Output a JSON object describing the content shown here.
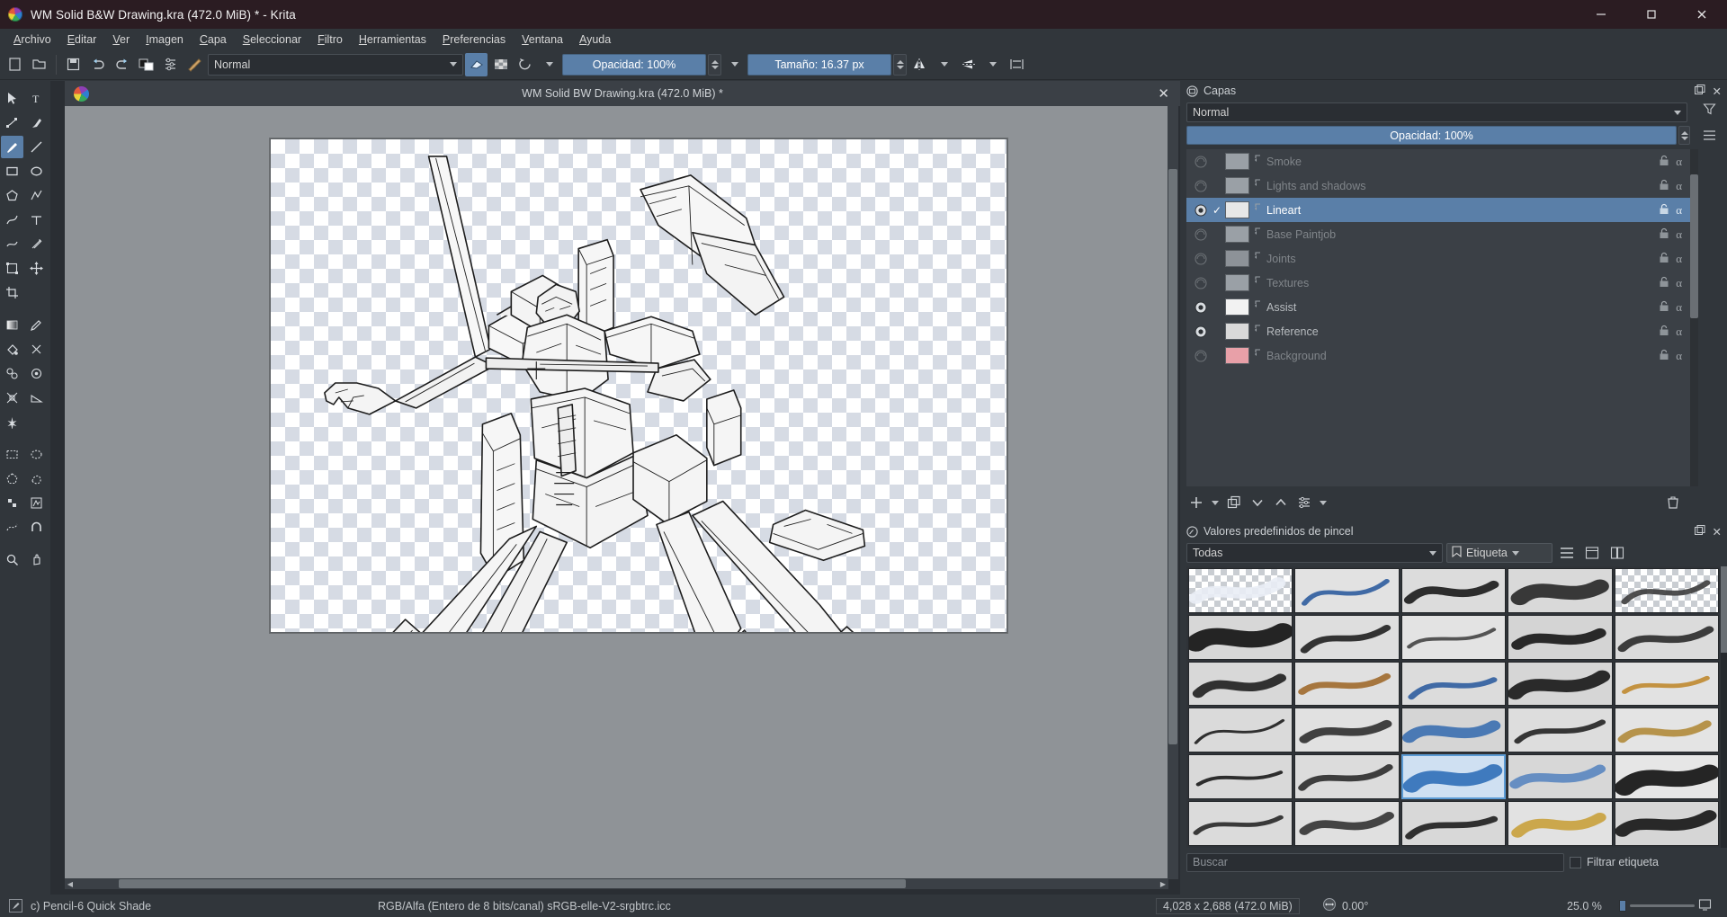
{
  "window": {
    "title": "WM Solid B&W Drawing.kra (472.0 MiB) * - Krita",
    "minimize_label": "—",
    "maximize_label": "❐",
    "close_label": "✕"
  },
  "menubar": {
    "items": [
      {
        "label": "Archivo"
      },
      {
        "label": "Editar"
      },
      {
        "label": "Ver"
      },
      {
        "label": "Imagen"
      },
      {
        "label": "Capa"
      },
      {
        "label": "Seleccionar"
      },
      {
        "label": "Filtro"
      },
      {
        "label": "Herramientas"
      },
      {
        "label": "Preferencias"
      },
      {
        "label": "Ventana"
      },
      {
        "label": "Ayuda"
      }
    ]
  },
  "toolbar": {
    "blend_mode": "Normal",
    "opacity_label": "Opacidad: 100%",
    "size_label": "Tamaño: 16.37 px"
  },
  "canvas": {
    "document_title": "WM Solid BW Drawing.kra (472.0 MiB) *",
    "close_label": "✕"
  },
  "layers_docker": {
    "title": "Capas",
    "blend_mode": "Normal",
    "opacity_label": "Opacidad: 100%",
    "float_label": "❐",
    "close_label": "✕",
    "items": [
      {
        "name": "Smoke",
        "visible": false,
        "selected": false,
        "checked": false,
        "thumb": "#9aa0a6"
      },
      {
        "name": "Lights and shadows",
        "visible": false,
        "selected": false,
        "checked": false,
        "thumb": "#9aa0a6"
      },
      {
        "name": "Lineart",
        "visible": true,
        "selected": true,
        "checked": true,
        "thumb": "#e7e7e7"
      },
      {
        "name": "Base Paintjob",
        "visible": false,
        "selected": false,
        "checked": false,
        "thumb": "#9aa0a6"
      },
      {
        "name": "Joints",
        "visible": false,
        "selected": false,
        "checked": false,
        "thumb": "#8d9298"
      },
      {
        "name": "Textures",
        "visible": false,
        "selected": false,
        "checked": false,
        "thumb": "#9aa0a6"
      },
      {
        "name": "Assist",
        "visible": true,
        "selected": false,
        "checked": false,
        "thumb": "#f2f2f2"
      },
      {
        "name": "Reference",
        "visible": true,
        "selected": false,
        "checked": false,
        "thumb": "#d9d9d9"
      },
      {
        "name": "Background",
        "visible": false,
        "selected": false,
        "checked": false,
        "thumb": "#e8a0a8"
      }
    ]
  },
  "brush_docker": {
    "title": "Valores predefinidos de pincel",
    "filter_all": "Todas",
    "tag_label": "Etiqueta",
    "search_placeholder": "Buscar",
    "filter_tag_label": "Filtrar etiqueta",
    "selected_index": 22
  },
  "statusbar": {
    "preset_name": "c) Pencil-6 Quick Shade",
    "colorspace": "RGB/Alfa (Entero de 8 bits/canal)  sRGB-elle-V2-srgbtrc.icc",
    "dimensions": "4,028 x 2,688 (472.0 MiB)",
    "rotation": "0.00°",
    "zoom": "25.0 %"
  },
  "colors": {
    "accent": "#5a7fa8",
    "chrome": "#31363b",
    "titlebar": "#2b1c22",
    "canvas_bg": "#8f9397"
  }
}
